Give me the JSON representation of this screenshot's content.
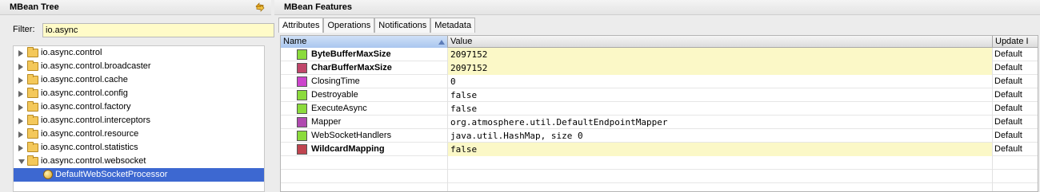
{
  "left_panel": {
    "title": "MBean Tree",
    "filter_label": "Filter:",
    "filter_value": "io.async",
    "tree": [
      {
        "label": "io.async.control",
        "expanded": false
      },
      {
        "label": "io.async.control.broadcaster",
        "expanded": false
      },
      {
        "label": "io.async.control.cache",
        "expanded": false
      },
      {
        "label": "io.async.control.config",
        "expanded": false
      },
      {
        "label": "io.async.control.factory",
        "expanded": false
      },
      {
        "label": "io.async.control.interceptors",
        "expanded": false
      },
      {
        "label": "io.async.control.resource",
        "expanded": false
      },
      {
        "label": "io.async.control.statistics",
        "expanded": false
      },
      {
        "label": "io.async.control.websocket",
        "expanded": true
      },
      {
        "label": "DefaultWebSocketProcessor",
        "child": true,
        "selected": true
      }
    ]
  },
  "right_panel": {
    "title": "MBean Features",
    "tabs": [
      "Attributes",
      "Operations",
      "Notifications",
      "Metadata"
    ],
    "active_tab": "Attributes",
    "columns": {
      "name": "Name",
      "value": "Value",
      "update": "Update I"
    },
    "rows": [
      {
        "name": "ByteBufferMaxSize",
        "value": "2097152",
        "update": "Default",
        "color": "#8bdb3c",
        "bold": true,
        "highlight": true
      },
      {
        "name": "CharBufferMaxSize",
        "value": "2097152",
        "update": "Default",
        "color": "#c0466a",
        "bold": true,
        "highlight": true
      },
      {
        "name": "ClosingTime",
        "value": "0",
        "update": "Default",
        "color": "#cc44cc",
        "bold": false,
        "highlight": false
      },
      {
        "name": "Destroyable",
        "value": "false",
        "update": "Default",
        "color": "#8bdb3c",
        "bold": false,
        "highlight": false
      },
      {
        "name": "ExecuteAsync",
        "value": "false",
        "update": "Default",
        "color": "#8bdb3c",
        "bold": false,
        "highlight": false
      },
      {
        "name": "Mapper",
        "value": "org.atmosphere.util.DefaultEndpointMapper",
        "update": "Default",
        "color": "#b04ab0",
        "bold": false,
        "highlight": false
      },
      {
        "name": "WebSocketHandlers",
        "value": "java.util.HashMap, size 0",
        "update": "Default",
        "color": "#8bdb3c",
        "bold": false,
        "highlight": false
      },
      {
        "name": "WildcardMapping",
        "value": "false",
        "update": "Default",
        "color": "#c0444f",
        "bold": true,
        "highlight": true
      }
    ]
  }
}
